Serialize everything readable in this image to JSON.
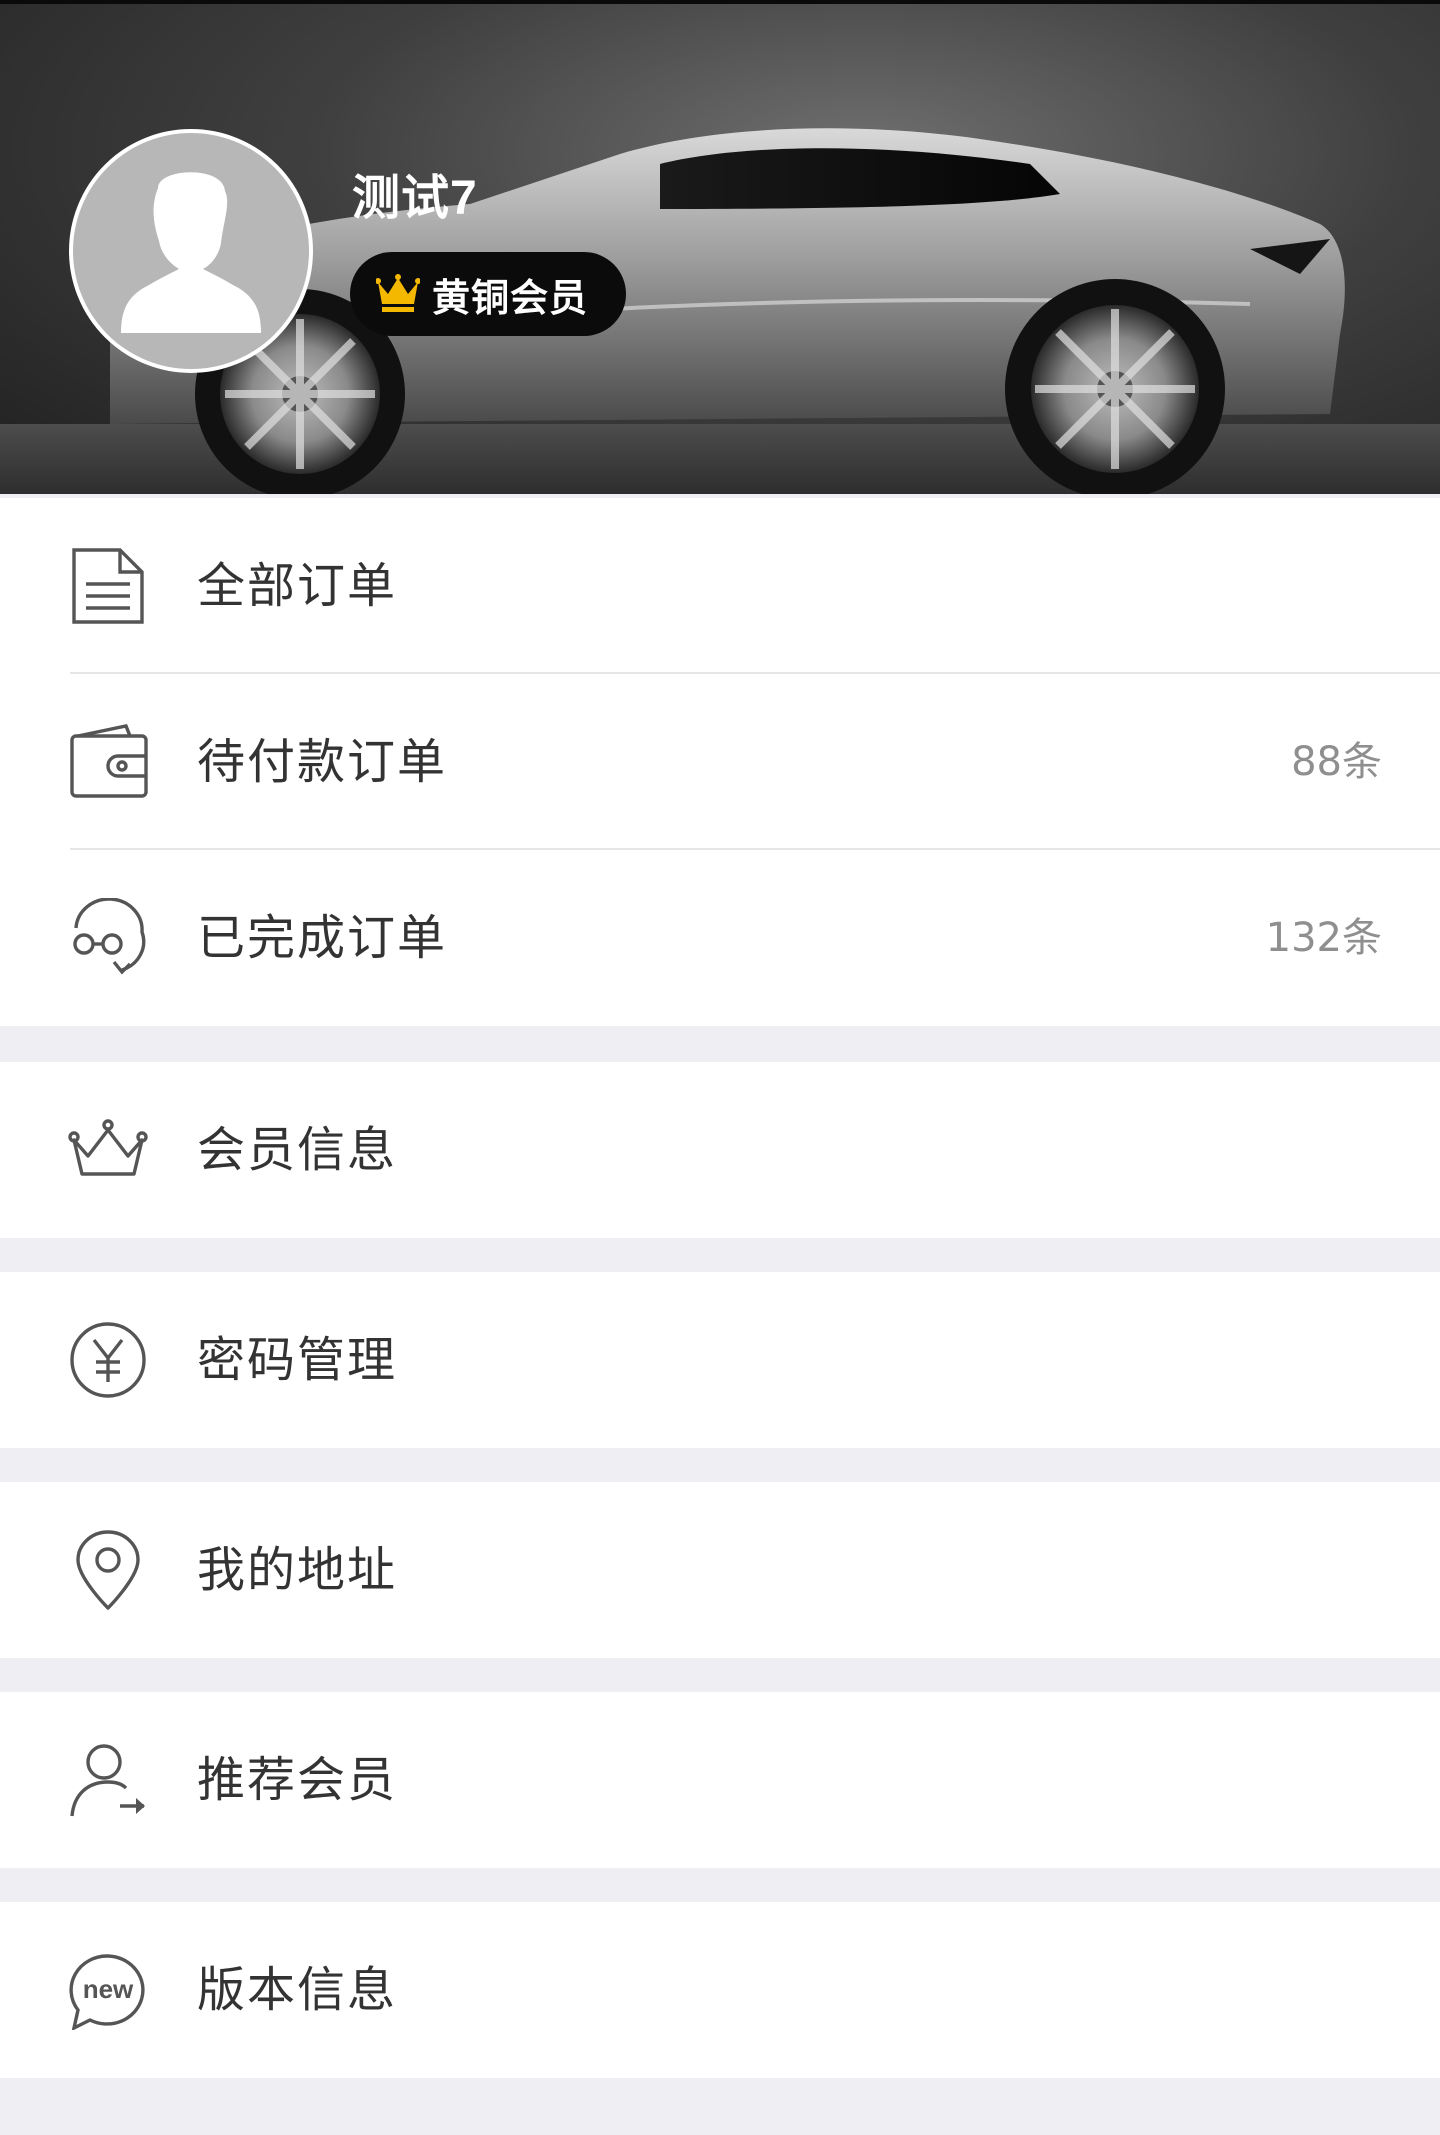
{
  "profile": {
    "name": "测试7",
    "membership_level": "黄铜会员"
  },
  "colors": {
    "badge_background": "#0b0b0b",
    "crown": "#f4b800",
    "text_primary": "#333333",
    "text_secondary": "#8f8f8f",
    "separator": "#efeef3"
  },
  "orders": [
    {
      "label": "全部订单",
      "icon": "document-icon"
    },
    {
      "label": "待付款订单",
      "count": "88条",
      "icon": "wallet-icon"
    },
    {
      "label": "已完成订单",
      "count": "132条",
      "icon": "completed-icon"
    }
  ],
  "menu": {
    "member_info": {
      "label": "会员信息",
      "icon": "crown-icon"
    },
    "password": {
      "label": "密码管理",
      "icon": "yen-circle-icon"
    },
    "address": {
      "label": "我的地址",
      "icon": "location-pin-icon"
    },
    "referral": {
      "label": "推荐会员",
      "icon": "user-share-icon"
    },
    "version": {
      "label": "版本信息",
      "icon": "new-badge-icon"
    }
  }
}
